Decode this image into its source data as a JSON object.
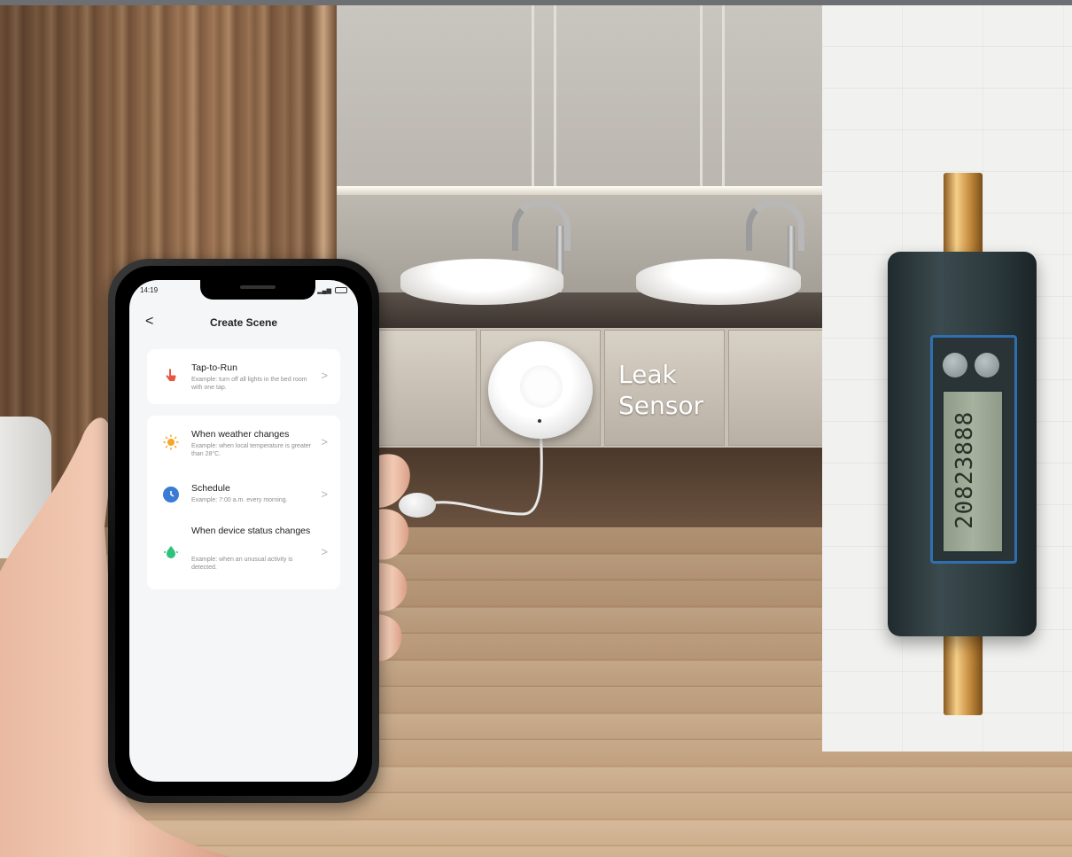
{
  "scene": {
    "label_line1": "Leak",
    "label_line2": "Sensor",
    "meter_digits": "20823888"
  },
  "phone": {
    "status_time": "14:19",
    "screen_title": "Create Scene",
    "back_glyph": "<",
    "tap_to_run": {
      "title": "Tap-to-Run",
      "subtitle": "Example: turn off all lights in the bed room with one tap."
    },
    "conditions": [
      {
        "title": "When weather changes",
        "subtitle": "Example: when local temperature is greater than 28°C.",
        "icon": "sun-icon",
        "color": "#f5a623"
      },
      {
        "title": "Schedule",
        "subtitle": "Example: 7:00 a.m. every morning.",
        "icon": "clock-icon",
        "color": "#3a7bd5"
      },
      {
        "title": "When device status changes",
        "subtitle": "Example: when an unusual activity is detected.",
        "icon": "device-icon",
        "color": "#2ec27e"
      }
    ],
    "chevron": ">",
    "tap_icon_color": "#e8563f"
  }
}
